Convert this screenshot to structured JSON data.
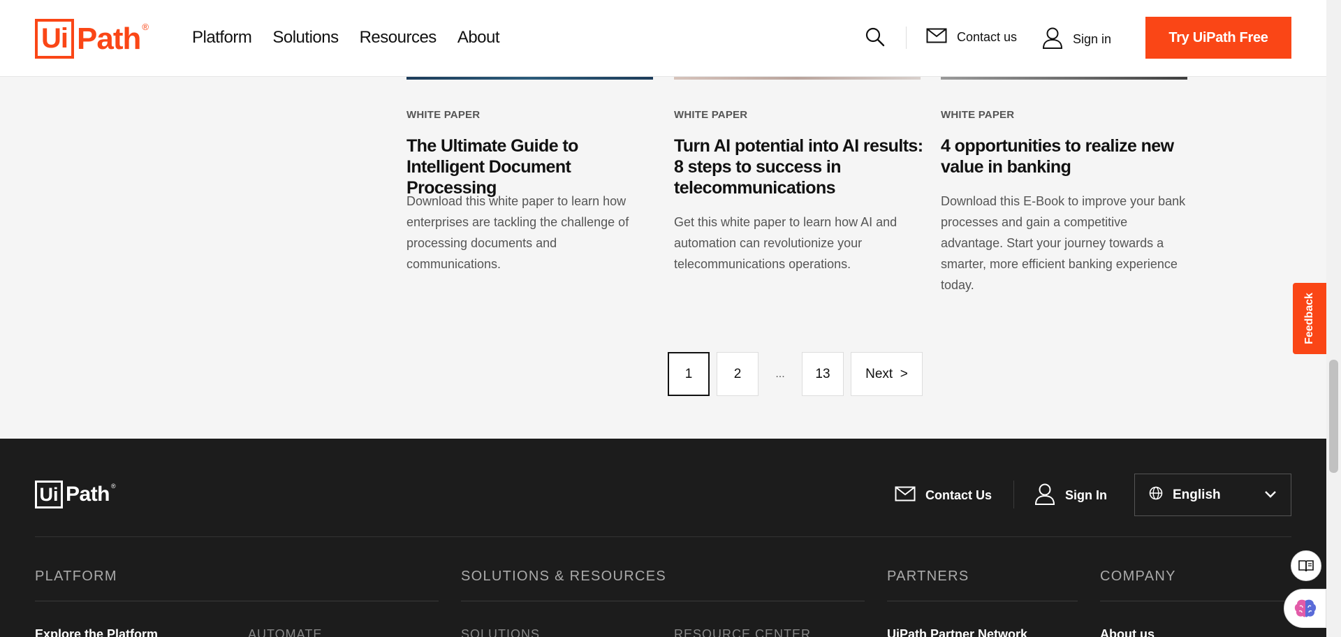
{
  "header": {
    "logo": "UiPath",
    "nav": [
      "Platform",
      "Solutions",
      "Resources",
      "About"
    ],
    "contact_label": "Contact us",
    "signin_label": "Sign in",
    "cta_label": "Try UiPath Free"
  },
  "cards": [
    {
      "category": "WHITE PAPER",
      "title": "The Ultimate Guide to Intelligent Document Processing",
      "description": "Download this white paper to learn how enterprises are tackling the challenge of processing documents and communications."
    },
    {
      "category": "WHITE PAPER",
      "title": "Turn AI potential into AI results: 8 steps to success in telecommunications",
      "description": "Get this white paper to learn how AI and automation can revolutionize your telecommunications operations."
    },
    {
      "category": "WHITE PAPER",
      "title": "4 opportunities to realize new value in banking",
      "description": "Download this E-Book to improve your bank processes and gain a competitive advantage. Start your journey towards a smarter, more efficient banking experience today."
    }
  ],
  "pagination": {
    "pages": [
      "1",
      "2",
      "...",
      "13"
    ],
    "current": "1",
    "next_label": "Next  >"
  },
  "feedback_label": "Feedback",
  "footer": {
    "logo": "UiPath",
    "contact_label": "Contact Us",
    "signin_label": "Sign In",
    "language": "English",
    "columns": {
      "platform": "PLATFORM",
      "solutions": "SOLUTIONS & RESOURCES",
      "partners": "PARTNERS",
      "company": "COMPANY"
    },
    "subs": {
      "explore": "Explore the Platform",
      "automate": "AUTOMATE",
      "solutions": "SOLUTIONS",
      "resource_center": "RESOURCE CENTER",
      "partner_network": "UiPath Partner Network",
      "about": "About us"
    }
  },
  "colors": {
    "brand": "#fa4616",
    "footer_bg": "#1c1c1c",
    "page_bg": "#f5f5f5"
  }
}
